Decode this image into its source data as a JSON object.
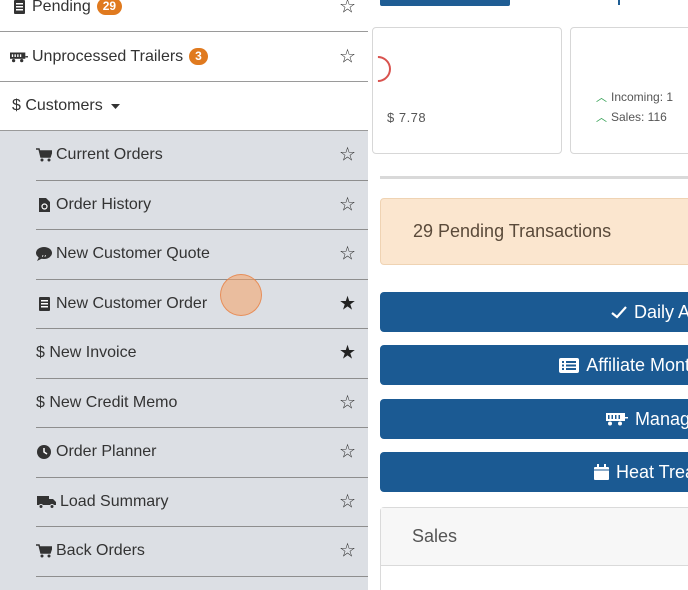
{
  "sidebar": {
    "top_items": [
      {
        "label": "Pending",
        "badge": "29",
        "icon": "document-icon",
        "starred": false
      },
      {
        "label": "Unprocessed Trailers",
        "badge": "3",
        "icon": "trailer-icon",
        "starred": false
      },
      {
        "label": "$ Customers",
        "icon": "caret-down-icon"
      }
    ],
    "customer_items": [
      {
        "label": "Current Orders",
        "icon": "cart-icon",
        "starred": false
      },
      {
        "label": "Order History",
        "icon": "file-icon",
        "starred": false
      },
      {
        "label": "New Customer Quote",
        "icon": "quote-bubble-icon",
        "starred": false
      },
      {
        "label": "New Customer Order",
        "icon": "document-icon",
        "starred": true
      },
      {
        "label": "$ New Invoice",
        "icon": "dollar-icon",
        "starred": true
      },
      {
        "label": "$ New Credit Memo",
        "icon": "dollar-icon",
        "starred": false
      },
      {
        "label": "Order Planner",
        "icon": "clock-icon",
        "starred": false
      },
      {
        "label": "Load Summary",
        "icon": "truck-icon",
        "starred": false
      },
      {
        "label": "Back Orders",
        "icon": "cart-icon",
        "starred": false
      }
    ]
  },
  "main": {
    "card1": {
      "amount": "$ 7.78"
    },
    "card2": {
      "incoming": "Incoming: 1",
      "sales": "Sales: 116"
    },
    "pending_text": "29 Pending Transactions",
    "buttons": [
      {
        "label": "Daily Ap",
        "icon": "check-icon"
      },
      {
        "label": "Affiliate Month",
        "icon": "list-icon"
      },
      {
        "label": "Manage",
        "icon": "trailer-icon"
      },
      {
        "label": "Heat Treat",
        "icon": "calendar-icon"
      }
    ],
    "sales_title": "Sales"
  },
  "colors": {
    "badge": "#e07a1f",
    "primary_button": "#1b5a93",
    "pending_bg": "#fbe6cf",
    "sidebar_group_bg": "#dcdfe4"
  }
}
